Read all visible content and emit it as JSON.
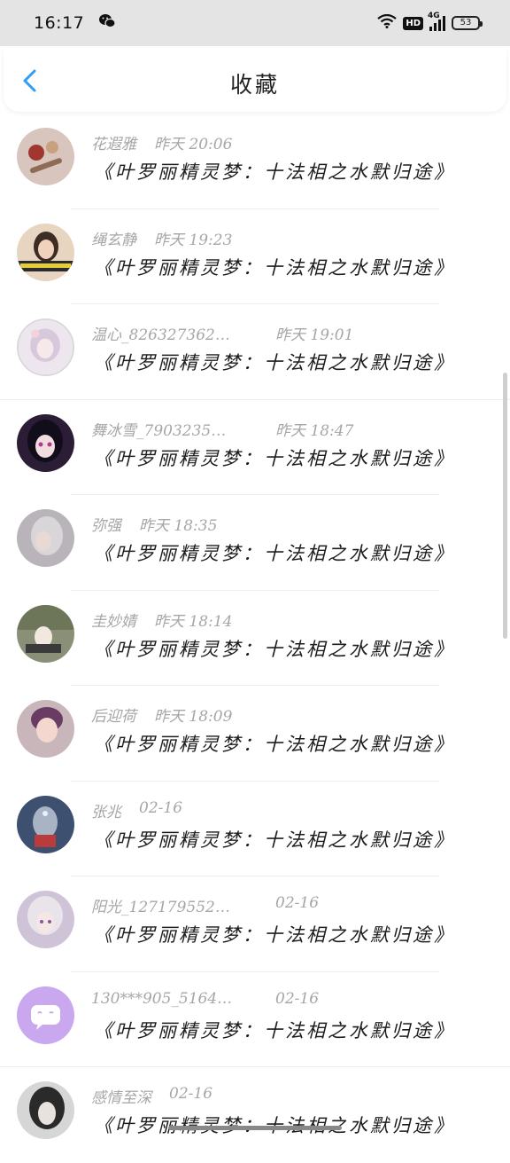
{
  "status_bar": {
    "time": "16:17",
    "network": "4G",
    "hd": "HD",
    "battery": "53"
  },
  "header": {
    "title": "收藏",
    "accent_color": "#2e9df7"
  },
  "items": [
    {
      "name": "花遐雅",
      "time": "昨天 20:06",
      "content": "《叶罗丽精灵梦：十法相之水默归途》",
      "avatar_color": "#d8c5bd"
    },
    {
      "name": "绳玄静",
      "time": "昨天 19:23",
      "content": "《叶罗丽精灵梦：十法相之水默归途》",
      "avatar_color": "#c9a98f"
    },
    {
      "name": "温心_826327362…",
      "time": "昨天 19:01",
      "content": "《叶罗丽精灵梦：十法相之水默归途》",
      "avatar_color": "#e6dde8"
    },
    {
      "name": "舞冰雪_7903235…",
      "time": "昨天 18:47",
      "content": "《叶罗丽精灵梦：十法相之水默归途》",
      "avatar_color": "#3a2a4a"
    },
    {
      "name": "弥强",
      "time": "昨天 18:35",
      "content": "《叶罗丽精灵梦：十法相之水默归途》",
      "avatar_color": "#b9b4b9"
    },
    {
      "name": "圭妙婧",
      "time": "昨天 18:14",
      "content": "《叶罗丽精灵梦：十法相之水默归途》",
      "avatar_color": "#7d8670"
    },
    {
      "name": "后迎荷",
      "time": "昨天 18:09",
      "content": "《叶罗丽精灵梦：十法相之水默归途》",
      "avatar_color": "#c7a1a6"
    },
    {
      "name": "张兆",
      "time": "02-16",
      "content": "《叶罗丽精灵梦：十法相之水默归途》",
      "avatar_color": "#3e5070"
    },
    {
      "name": "阳光_127179552…",
      "time": "02-16",
      "content": "《叶罗丽精灵梦：十法相之水默归途》",
      "avatar_color": "#cfc3d8"
    },
    {
      "name": "130***905_5164…",
      "time": "02-16",
      "content": "《叶罗丽精灵梦：十法相之水默归途》",
      "avatar_color": "#c9a8ef"
    },
    {
      "name": "感情至深",
      "time": "02-16",
      "content": "《叶罗丽精灵梦：十法相之水默归途》",
      "avatar_color": "#9a9a9a"
    }
  ]
}
